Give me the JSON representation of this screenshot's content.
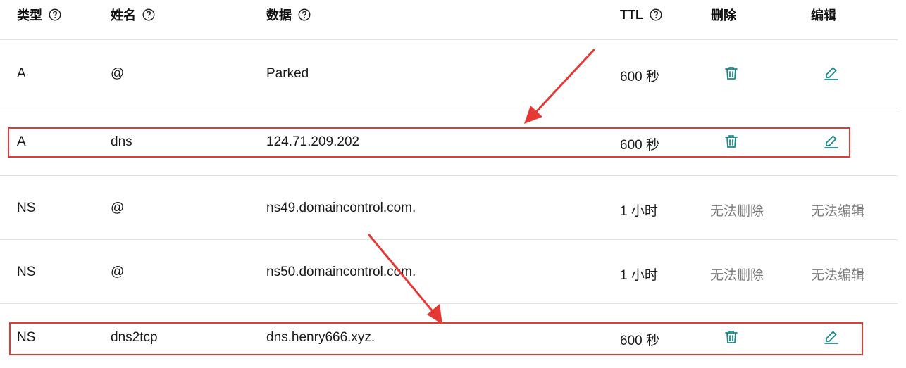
{
  "headers": {
    "type": "类型",
    "name": "姓名",
    "data": "数据",
    "ttl": "TTL",
    "delete": "删除",
    "edit": "编辑"
  },
  "rows": [
    {
      "type": "A",
      "name": "@",
      "data": "Parked",
      "ttl": "600 秒",
      "delete": "trash-icon",
      "edit": "pencil-icon"
    },
    {
      "type": "A",
      "name": "dns",
      "data": "124.71.209.202",
      "ttl": "600 秒",
      "delete": "trash-icon",
      "edit": "pencil-icon"
    },
    {
      "type": "NS",
      "name": "@",
      "data": "ns49.domaincontrol.com.",
      "ttl": "1 小时",
      "delete_text": "无法删除",
      "edit_text": "无法编辑"
    },
    {
      "type": "NS",
      "name": "@",
      "data": "ns50.domaincontrol.com.",
      "ttl": "1 小时",
      "delete_text": "无法删除",
      "edit_text": "无法编辑"
    },
    {
      "type": "NS",
      "name": "dns2tcp",
      "data": "dns.henry666.xyz.",
      "ttl": "600 秒",
      "delete": "trash-icon",
      "edit": "pencil-icon"
    }
  ],
  "colors": {
    "icon": "#1a8a8a",
    "annotation": "#e53935",
    "disabled_text": "#7c7c7c"
  }
}
